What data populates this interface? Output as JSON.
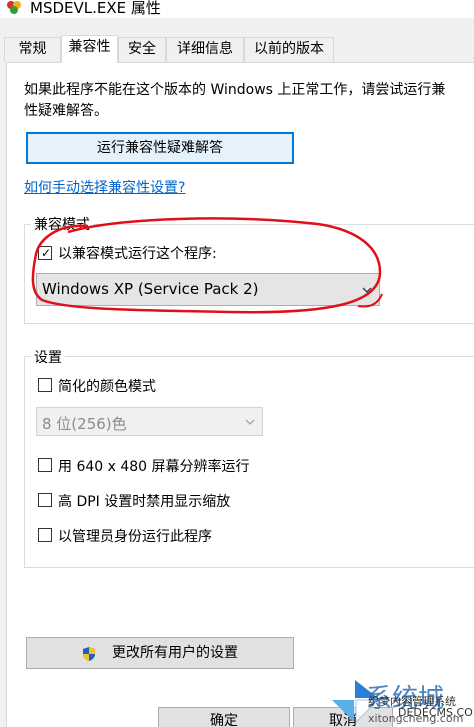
{
  "window": {
    "title": "MSDEVL.EXE 属性"
  },
  "tabs": [
    {
      "label": "常规"
    },
    {
      "label": "兼容性"
    },
    {
      "label": "安全"
    },
    {
      "label": "详细信息"
    },
    {
      "label": "以前的版本"
    }
  ],
  "compat": {
    "intro_line1": "如果此程序不能在这个版本的 Windows 上正常工作，请尝试运行兼",
    "intro_line2": "性疑难解答。",
    "troubleshoot_button": "运行兼容性疑难解答",
    "manual_link": "如何手动选择兼容性设置?",
    "mode_group_label": "兼容模式",
    "mode_checkbox_label": "以兼容模式运行这个程序:",
    "mode_checked": true,
    "mode_select_value": "Windows XP (Service Pack 2)"
  },
  "settings": {
    "group_label": "设置",
    "reduced_color_label": "简化的颜色模式",
    "color_select_value": "8 位(256)色",
    "res_640_label": "用 640 x 480 屏幕分辨率运行",
    "high_dpi_label": "高 DPI 设置时禁用显示缩放",
    "admin_label": "以管理员身份运行此程序"
  },
  "change_all_button": "更改所有用户的设置",
  "dialog_buttons": {
    "ok": "确定",
    "cancel": "取消"
  },
  "watermark": {
    "brand": "系统城",
    "sub": "织梦内容管理系统",
    "site": "DEDECMS.COM",
    "url": "xitongcheng.com"
  },
  "colors": {
    "focus_border": "#0078d7",
    "link": "#0066cc",
    "annotation_red": "#e0101a"
  }
}
